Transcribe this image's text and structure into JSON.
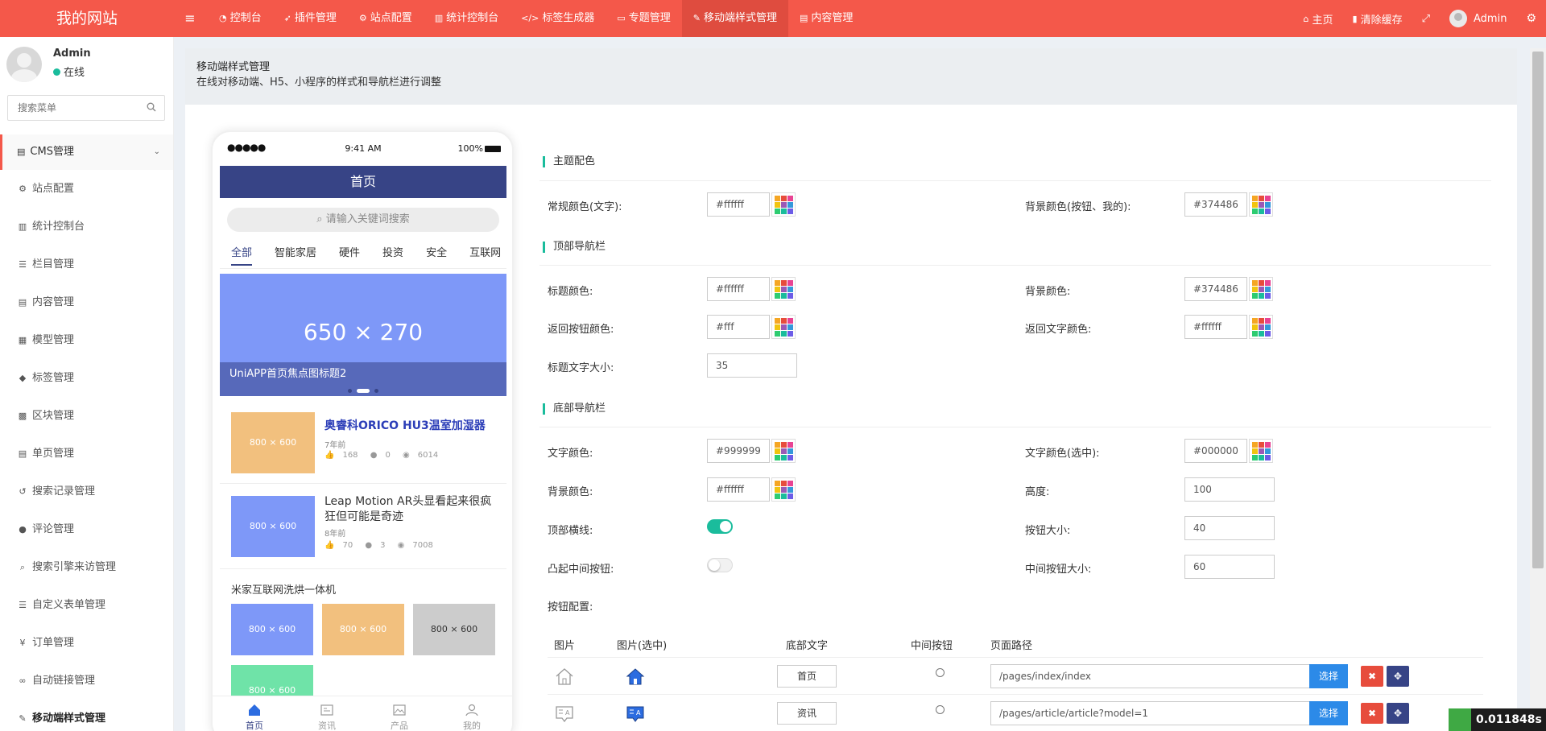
{
  "app": {
    "logo": "我的网站"
  },
  "topnav": {
    "tabs": [
      {
        "label": "控制台",
        "icon": "dashboard-icon"
      },
      {
        "label": "插件管理",
        "icon": "rocket-icon"
      },
      {
        "label": "站点配置",
        "icon": "gears-icon"
      },
      {
        "label": "统计控制台",
        "icon": "bar-chart-icon"
      },
      {
        "label": "标签生成器",
        "icon": "code-icon"
      },
      {
        "label": "专题管理",
        "icon": "card-icon"
      },
      {
        "label": "移动端样式管理",
        "icon": "magic-wand-icon"
      },
      {
        "label": "内容管理",
        "icon": "file-icon"
      }
    ],
    "home": "主页",
    "clear_cache": "清除缓存",
    "user": "Admin"
  },
  "sidebar": {
    "user_name": "Admin",
    "status": "在线",
    "search_placeholder": "搜索菜单",
    "group": "CMS管理",
    "items": [
      {
        "label": "站点配置",
        "glyph": "⚙"
      },
      {
        "label": "统计控制台",
        "glyph": "▥"
      },
      {
        "label": "栏目管理",
        "glyph": "☰"
      },
      {
        "label": "内容管理",
        "glyph": "▤"
      },
      {
        "label": "模型管理",
        "glyph": "▦"
      },
      {
        "label": "标签管理",
        "glyph": "◆"
      },
      {
        "label": "区块管理",
        "glyph": "▩"
      },
      {
        "label": "单页管理",
        "glyph": "▤"
      },
      {
        "label": "搜索记录管理",
        "glyph": "↺"
      },
      {
        "label": "评论管理",
        "glyph": "●"
      },
      {
        "label": "搜索引擎来访管理",
        "glyph": "⌕"
      },
      {
        "label": "自定义表单管理",
        "glyph": "☰"
      },
      {
        "label": "订单管理",
        "glyph": "¥"
      },
      {
        "label": "自动链接管理",
        "glyph": "∞"
      },
      {
        "label": "移动端样式管理",
        "glyph": "✎"
      }
    ]
  },
  "header": {
    "title": "移动端样式管理",
    "desc": "在线对移动端、H5、小程序的样式和导航栏进行调整"
  },
  "phone": {
    "signal": "●●●●●",
    "time": "9:41 AM",
    "battery": "100%",
    "nav_title": "首页",
    "search_placeholder": "请输入关键词搜索",
    "tabs": [
      "全部",
      "智能家居",
      "硬件",
      "投资",
      "安全",
      "互联网"
    ],
    "banner": {
      "size": "650 × 270",
      "caption": "UniAPP首页焦点图标题2",
      "slides": 3,
      "current": 1
    },
    "articles": [
      {
        "title": "奥睿科ORICO HU3温室加湿器",
        "time": "7年前",
        "likes": "168",
        "comments": "0",
        "views": "6014",
        "thumb": "800 × 600",
        "thumb_color": "#f2c07e"
      },
      {
        "title": "Leap Motion AR头显看起来很疯狂但可能是奇迹",
        "time": "8年前",
        "likes": "70",
        "comments": "3",
        "views": "7008",
        "thumb": "800 × 600",
        "thumb_color": "#7e98f8"
      }
    ],
    "group_title": "米家互联网洗烘一体机",
    "grid": [
      {
        "label": "800 × 600",
        "color": "#7e98f8"
      },
      {
        "label": "800 × 600",
        "color": "#f2c07e"
      },
      {
        "label": "800 × 600",
        "color": "#cccccc"
      },
      {
        "label": "800 × 600",
        "color": "#6fe3a8"
      }
    ],
    "tabbar": [
      "首页",
      "资讯",
      "产品",
      "我的"
    ]
  },
  "form": {
    "theme": {
      "title": "主题配色",
      "text_color_label": "常规颜色(文字):",
      "text_color": "#ffffff",
      "bg_color_label": "背景颜色(按钮、我的):",
      "bg_color": "#374486"
    },
    "top_nav": {
      "title": "顶部导航栏",
      "title_color_label": "标题颜色:",
      "title_color": "#ffffff",
      "bg_color_label": "背景颜色:",
      "bg_color": "#374486",
      "back_btn_color_label": "返回按钮颜色:",
      "back_btn_color": "#fff",
      "back_text_color_label": "返回文字颜色:",
      "back_text_color": "#ffffff",
      "title_size_label": "标题文字大小:",
      "title_size": "35"
    },
    "bottom_nav": {
      "title": "底部导航栏",
      "text_color_label": "文字颜色:",
      "text_color": "#999999",
      "text_color_sel_label": "文字颜色(选中):",
      "text_color_sel": "#000000",
      "bg_color_label": "背景颜色:",
      "bg_color": "#ffffff",
      "height_label": "高度:",
      "height": "100",
      "top_line_label": "顶部横线:",
      "top_line": true,
      "btn_size_label": "按钮大小:",
      "btn_size": "40",
      "raised_mid_label": "凸起中间按钮:",
      "raised_mid": false,
      "mid_btn_size_label": "中间按钮大小:",
      "mid_btn_size": "60",
      "btn_config_label": "按钮配置:"
    },
    "table": {
      "headers": [
        "图片",
        "图片(选中)",
        "底部文字",
        "中间按钮",
        "页面路径"
      ],
      "select_label": "选择",
      "rows": [
        {
          "text": "首页",
          "path": "/pages/index/index",
          "icon": "home-icon"
        },
        {
          "text": "资讯",
          "path": "/pages/article/article?model=1",
          "icon": "article-icon"
        }
      ]
    }
  },
  "timer": "0.011848s",
  "colors": {
    "brand": "#f4584a",
    "theme": "#374486",
    "accent": "#1abc9c",
    "select": "#2c8ae8",
    "danger": "#e74c3c"
  }
}
